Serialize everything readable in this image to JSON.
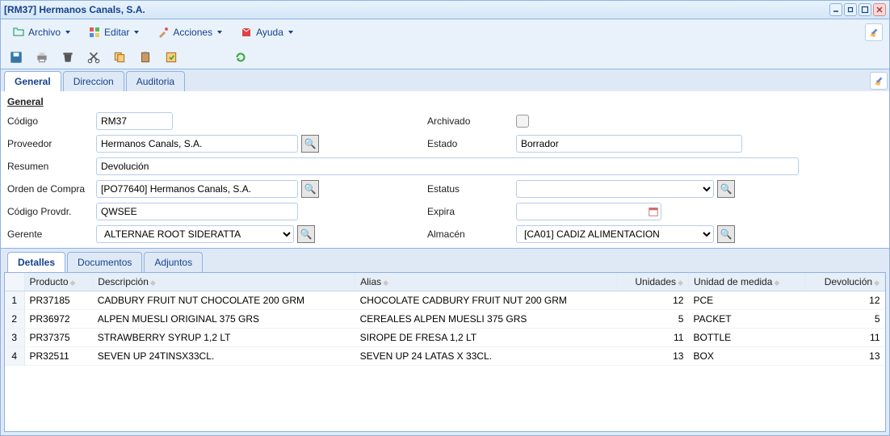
{
  "window": {
    "title": "[RM37] Hermanos Canals, S.A."
  },
  "menu": {
    "archivo": "Archivo",
    "editar": "Editar",
    "acciones": "Acciones",
    "ayuda": "Ayuda"
  },
  "tabs": {
    "general": "General",
    "direccion": "Direccion",
    "auditoria": "Auditoria"
  },
  "section": {
    "general_title": "General"
  },
  "labels": {
    "codigo": "Código",
    "proveedor": "Proveedor",
    "resumen": "Resumen",
    "orden_compra": "Orden de Compra",
    "codigo_provdr": "Código Provdr.",
    "gerente": "Gerente",
    "archivado": "Archivado",
    "estado": "Estado",
    "estatus": "Estatus",
    "expira": "Expira",
    "almacen": "Almacén"
  },
  "values": {
    "codigo": "RM37",
    "proveedor": "Hermanos Canals, S.A.",
    "resumen": "Devolución",
    "orden_compra": "[PO77640] Hermanos Canals, S.A.",
    "codigo_provdr": "QWSEE",
    "gerente": "ALTERNAE ROOT SIDERATTA",
    "estado": "Borrador",
    "estatus": "",
    "expira": "",
    "almacen": "[CA01] CADIZ ALIMENTACION"
  },
  "detail_tabs": {
    "detalles": "Detalles",
    "documentos": "Documentos",
    "adjuntos": "Adjuntos"
  },
  "columns": {
    "producto": "Producto",
    "descripcion": "Descripción",
    "alias": "Alias",
    "unidades": "Unidades",
    "uom": "Unidad de medida",
    "devolucion": "Devolución"
  },
  "rows": [
    {
      "idx": "1",
      "producto": "PR37185",
      "descripcion": "CADBURY FRUIT NUT CHOCOLATE 200 GRM",
      "alias": "CHOCOLATE CADBURY FRUIT NUT 200 GRM",
      "unidades": "12",
      "uom": "PCE",
      "devolucion": "12"
    },
    {
      "idx": "2",
      "producto": "PR36972",
      "descripcion": "ALPEN MUESLI ORIGINAL 375 GRS",
      "alias": "CEREALES ALPEN MUESLI 375 GRS",
      "unidades": "5",
      "uom": "PACKET",
      "devolucion": "5"
    },
    {
      "idx": "3",
      "producto": "PR37375",
      "descripcion": "STRAWBERRY SYRUP 1,2 LT",
      "alias": "SIROPE DE FRESA 1,2 LT",
      "unidades": "11",
      "uom": "BOTTLE",
      "devolucion": "11"
    },
    {
      "idx": "4",
      "producto": "PR32511",
      "descripcion": "SEVEN UP 24TINSX33CL.",
      "alias": "SEVEN UP 24 LATAS X 33CL.",
      "unidades": "13",
      "uom": "BOX",
      "devolucion": "13"
    }
  ]
}
